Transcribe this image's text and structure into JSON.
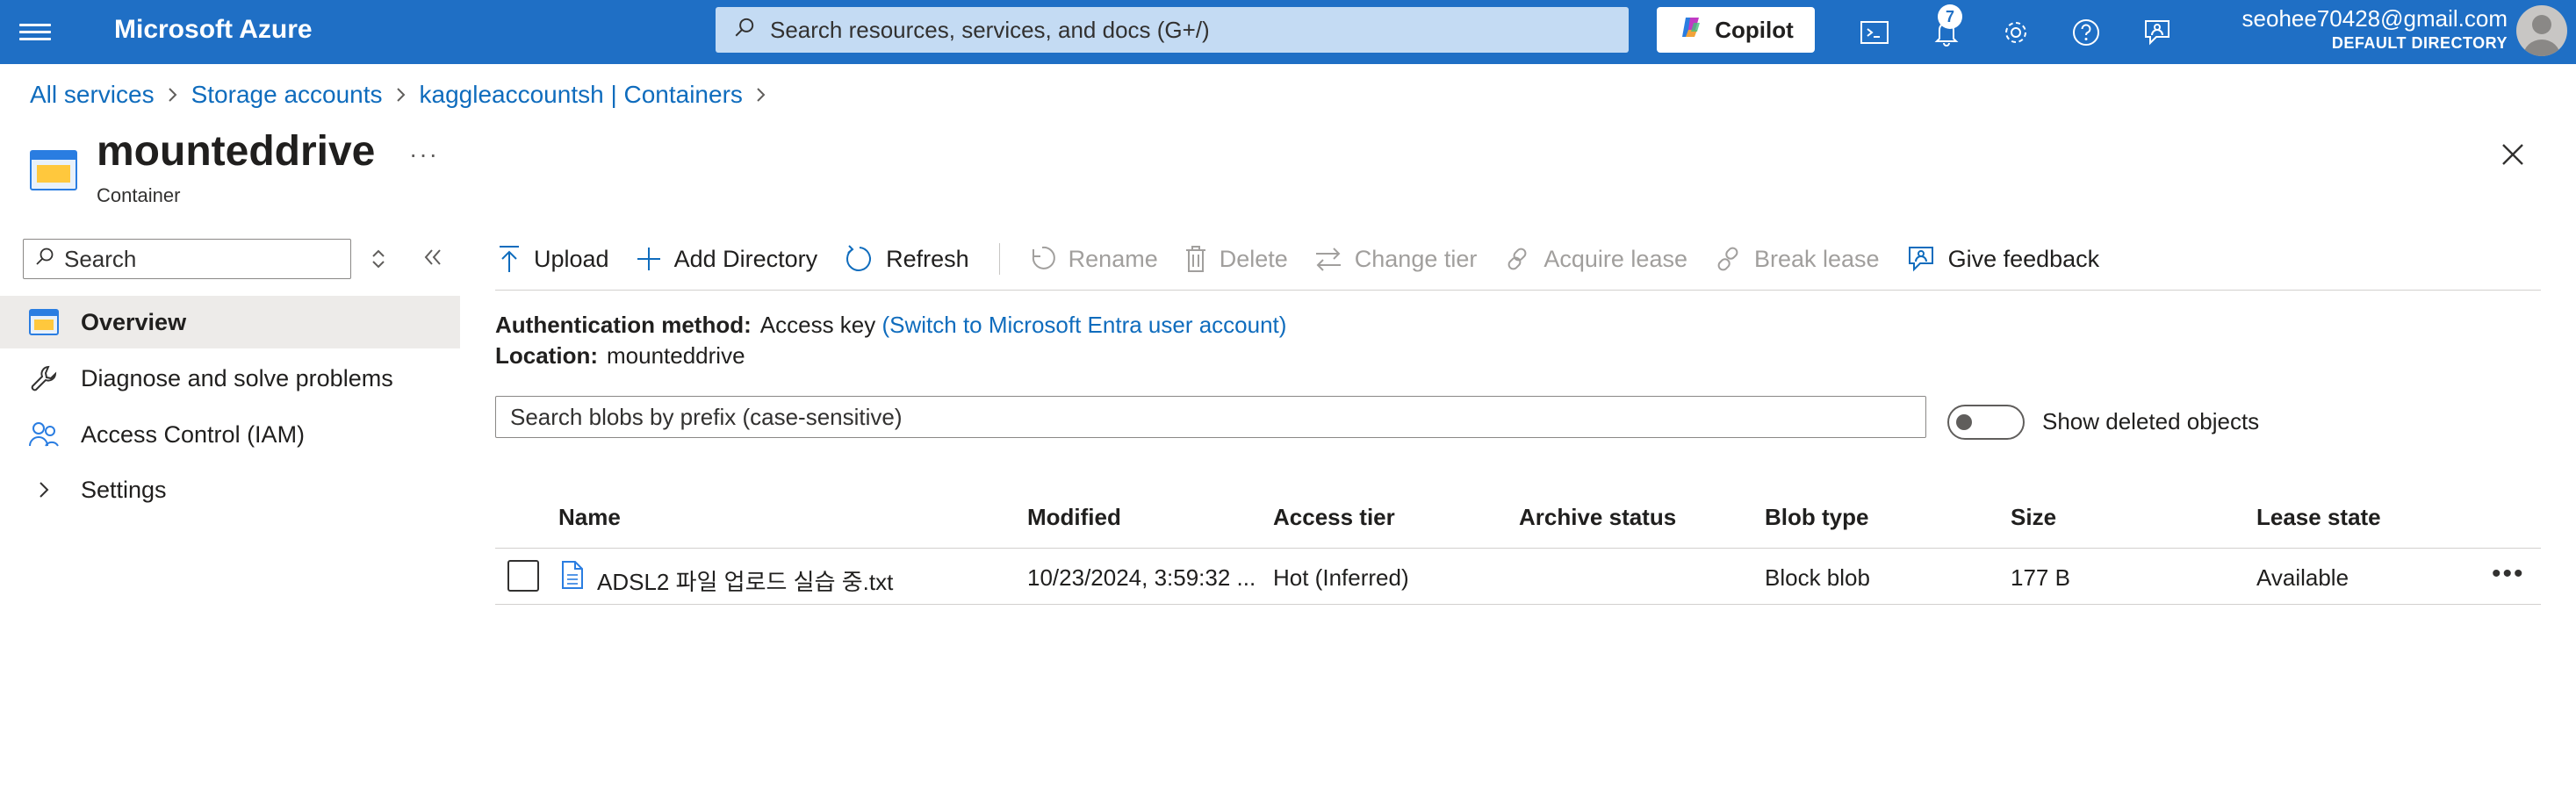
{
  "topbar": {
    "brand": "Microsoft Azure",
    "search_placeholder": "Search resources, services, and docs (G+/)",
    "copilot_label": "Copilot",
    "notifications_count": "7",
    "account_email": "seohee70428@gmail.com",
    "account_directory": "DEFAULT DIRECTORY",
    "icons": [
      "menu-icon",
      "cloud-shell-icon",
      "bell-icon",
      "gear-icon",
      "help-icon",
      "feedback-icon"
    ]
  },
  "breadcrumb": {
    "items": [
      "All services",
      "Storage accounts",
      "kaggleaccountsh | Containers"
    ]
  },
  "resource": {
    "title": "mounteddrive",
    "subtitle": "Container",
    "more": "···"
  },
  "sidebar": {
    "search_placeholder": "Search",
    "items": [
      {
        "label": "Overview",
        "icon": "container-icon",
        "selected": true
      },
      {
        "label": "Diagnose and solve problems",
        "icon": "wrench-icon"
      },
      {
        "label": "Access Control (IAM)",
        "icon": "people-icon"
      },
      {
        "label": "Settings",
        "icon": "chevron-right-icon"
      }
    ]
  },
  "toolbar": {
    "upload": "Upload",
    "add_directory": "Add Directory",
    "refresh": "Refresh",
    "rename": "Rename",
    "delete": "Delete",
    "change_tier": "Change tier",
    "acquire_lease": "Acquire lease",
    "break_lease": "Break lease",
    "give_feedback": "Give feedback"
  },
  "info": {
    "auth_label": "Authentication method:",
    "auth_value": "Access key",
    "auth_link": "(Switch to Microsoft Entra user account)",
    "location_label": "Location:",
    "location_value": "mounteddrive"
  },
  "blob_search": {
    "placeholder": "Search blobs by prefix (case-sensitive)",
    "show_deleted_label": "Show deleted objects",
    "show_deleted_on": false
  },
  "table": {
    "columns": [
      "Name",
      "Modified",
      "Access tier",
      "Archive status",
      "Blob type",
      "Size",
      "Lease state"
    ],
    "rows": [
      {
        "name": "ADSL2 파일 업로드 실습 중.txt",
        "modified": "10/23/2024, 3:59:32 ...",
        "access_tier": "Hot (Inferred)",
        "archive_status": "",
        "blob_type": "Block blob",
        "size": "177 B",
        "lease_state": "Available"
      }
    ]
  },
  "colors": {
    "topbar": "#1f6fc5",
    "link": "#0f6cbd",
    "selected_nav": "#edebe9"
  }
}
